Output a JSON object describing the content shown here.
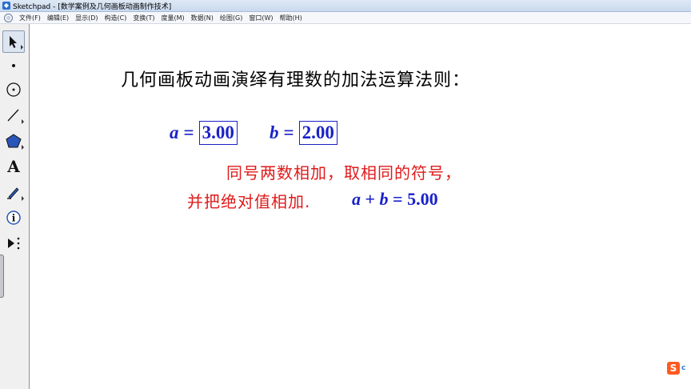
{
  "window": {
    "app_icon": "sketchpad-icon",
    "title": "Sketchpad - [数学案例及几何画板动画制作技术]"
  },
  "menu": {
    "items": [
      "文件(F)",
      "编辑(E)",
      "显示(D)",
      "构造(C)",
      "变换(T)",
      "度量(M)",
      "数据(N)",
      "绘图(G)",
      "窗口(W)",
      "帮助(H)"
    ]
  },
  "toolbox": {
    "tools": [
      "selection-arrow-icon",
      "point-icon",
      "compass-icon",
      "straightedge-icon",
      "polygon-icon",
      "text-tool-icon",
      "marker-icon",
      "information-icon",
      "custom-tool-icon"
    ],
    "text_tool_letter": "A",
    "info_letter": "i"
  },
  "document": {
    "heading": "几何画板动画演绎有理数的加法运算法则：",
    "param_a": {
      "name": "a",
      "eq": "=",
      "value": "3.00"
    },
    "param_b": {
      "name": "b",
      "eq": "=",
      "value": "2.00"
    },
    "rule_line1": "同号两数相加，取相同的符号，",
    "rule_line2": "并把绝对值相加.",
    "sum_expr": {
      "a": "a",
      "plus": "+",
      "b": "b",
      "eq": "=",
      "value": "5.00"
    }
  },
  "watermark": {
    "badge": "S",
    "text": "c"
  },
  "colors": {
    "blue": "#1a22c8",
    "red": "#e01a1a",
    "watermark_orange": "#ff5a1f"
  }
}
